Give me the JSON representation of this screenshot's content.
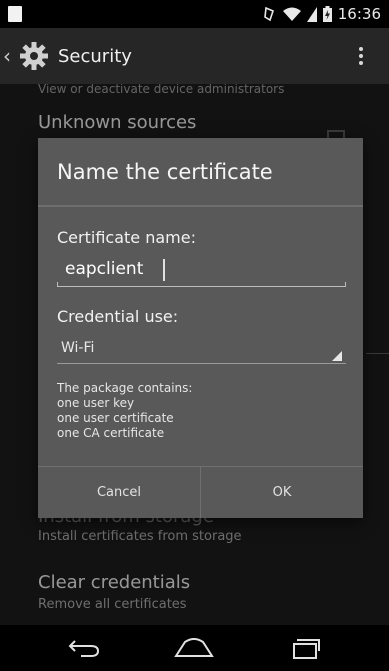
{
  "status_bar": {
    "time": "16:36"
  },
  "action_bar": {
    "title": "Security"
  },
  "background_list": {
    "cut_off_summary": "View or deactivate device administrators",
    "unknown_sources_title": "Unknown sources",
    "install_from_storage_title": "Install from storage",
    "install_from_storage_summary": "Install certificates from storage",
    "clear_credentials_title": "Clear credentials",
    "clear_credentials_summary": "Remove all certificates"
  },
  "dialog": {
    "title": "Name the certificate",
    "certificate_name_label": "Certificate name:",
    "certificate_name_value": "eapclient",
    "credential_use_label": "Credential use:",
    "credential_use_value": "Wi-Fi",
    "package_info": [
      "The package contains:",
      "one user key",
      "one user certificate",
      "one CA certificate"
    ],
    "cancel_label": "Cancel",
    "ok_label": "OK"
  },
  "icons": {
    "status": [
      "sim-icon",
      "rotation-icon",
      "wifi-icon",
      "signal-icon",
      "battery-icon"
    ],
    "action_bar": [
      "back-chevron-icon",
      "settings-gear-icon",
      "overflow-menu-icon"
    ],
    "nav_bar": [
      "back-nav-icon",
      "home-nav-icon",
      "recents-nav-icon"
    ]
  }
}
